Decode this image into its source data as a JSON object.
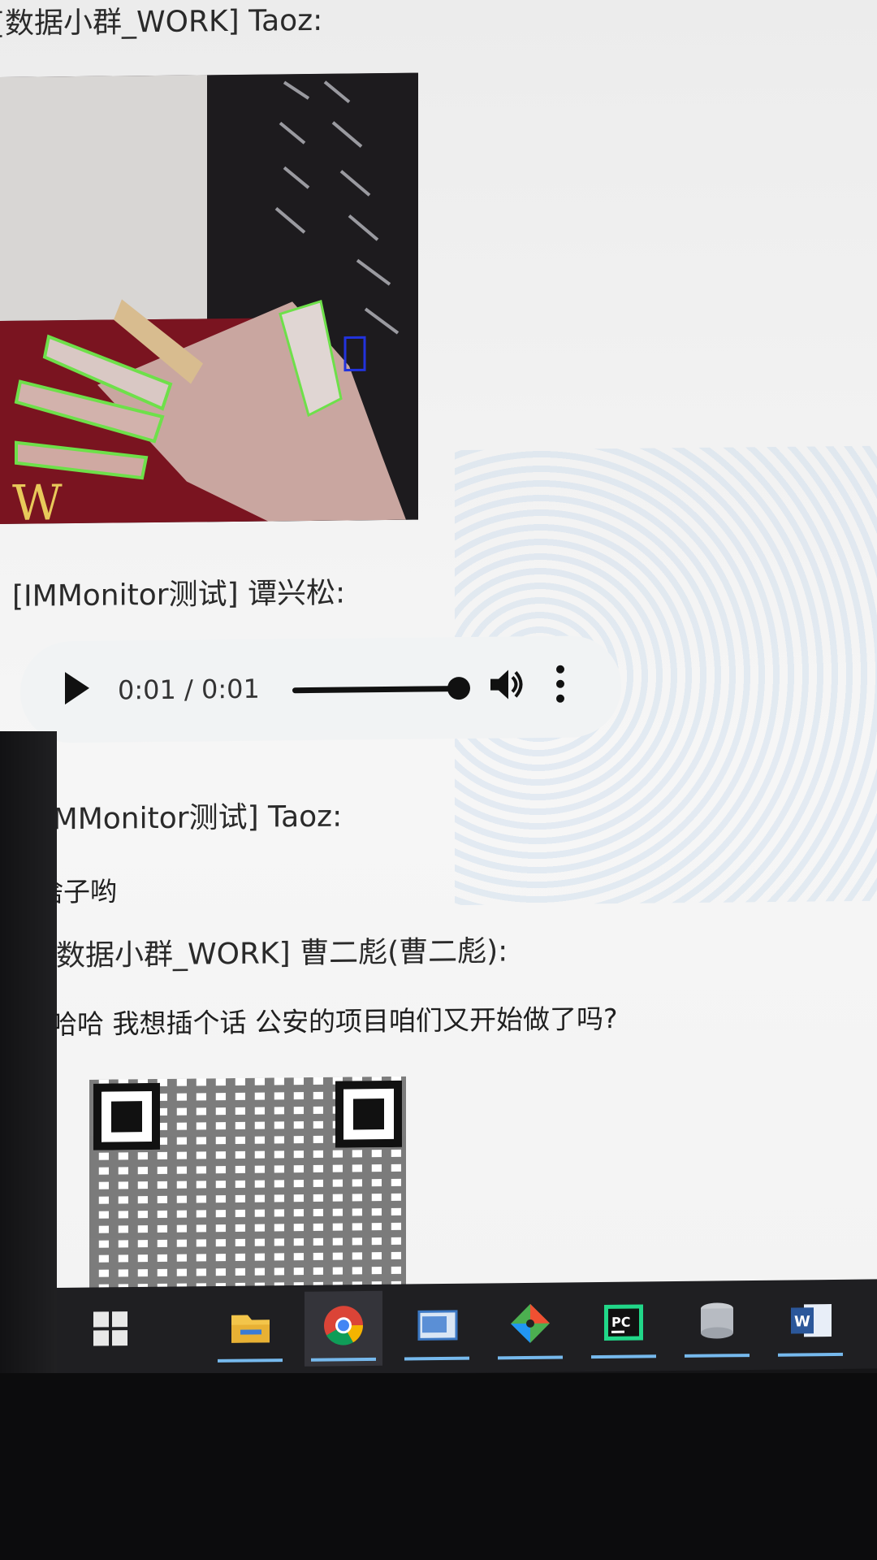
{
  "conversation": {
    "messages": [
      {
        "sender": "[数据小群_WORK] Taoz:",
        "kind": "image",
        "image_alt": "hand photo"
      },
      {
        "sender": "[IMMonitor测试] 谭兴松:",
        "kind": "audio"
      },
      {
        "sender": "[IMMonitor测试] Taoz:",
        "text": "啥子哟"
      },
      {
        "sender": "[数据小群_WORK] 曹二彪(曹二彪):",
        "text": "哈哈 我想插个话 公安的项目咱们又开始做了吗?"
      }
    ],
    "first_sender_visible": "[数据小群_WORK] Taoz:"
  },
  "audio_player": {
    "time": "0:01 / 0:01",
    "progress": 1.0,
    "icons": {
      "play": "play-icon",
      "volume": "volume-icon",
      "more": "more-vert-icon"
    }
  },
  "taskbar": {
    "items": [
      {
        "name": "start",
        "icon": "windows-logo-icon"
      },
      {
        "name": "file-explorer",
        "icon": "folder-icon"
      },
      {
        "name": "chrome",
        "icon": "chrome-icon"
      },
      {
        "name": "app-window",
        "icon": "window-icon"
      },
      {
        "name": "git",
        "icon": "git-diamond-icon"
      },
      {
        "name": "pycharm",
        "icon": "pycharm-icon"
      },
      {
        "name": "database",
        "icon": "database-icon"
      },
      {
        "name": "word",
        "icon": "word-icon"
      }
    ],
    "accent": "#76b9ed"
  },
  "colors": {
    "page_bg": "#f2f2f2",
    "text": "#222222",
    "taskbar_bg": "#1f1f22"
  }
}
